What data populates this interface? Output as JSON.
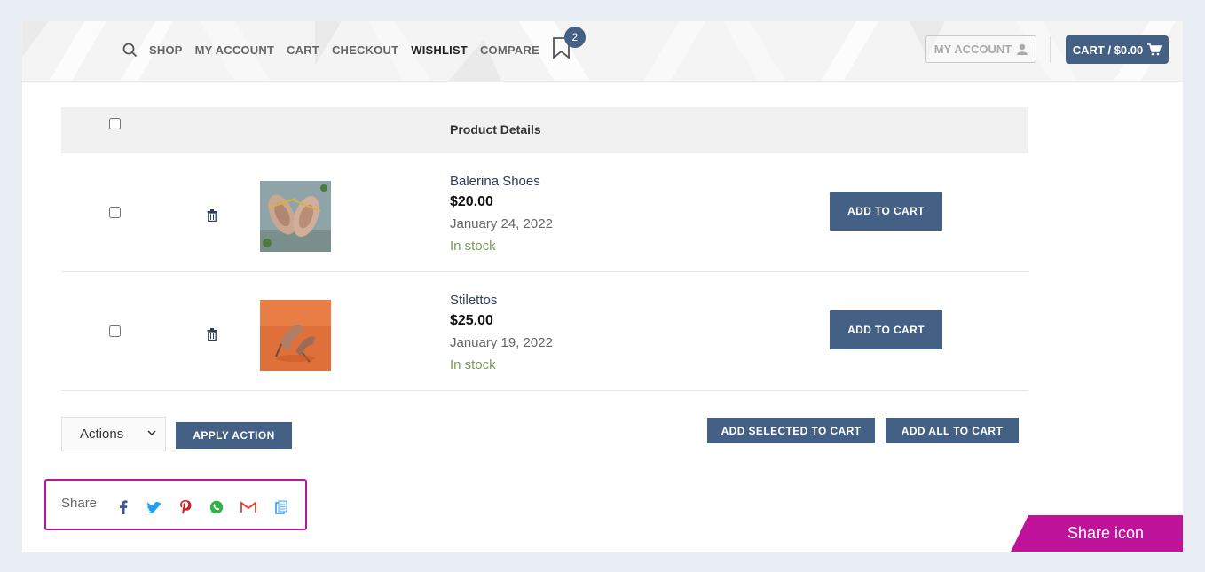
{
  "nav": {
    "items": [
      "SHOP",
      "MY ACCOUNT",
      "CART",
      "CHECKOUT",
      "WISHLIST",
      "COMPARE"
    ],
    "active": "WISHLIST",
    "wishlist_count": "2"
  },
  "header": {
    "account_button": "MY ACCOUNT",
    "cart_button": "CART / $0.00"
  },
  "table": {
    "header": "Product Details",
    "rows": [
      {
        "name": "Balerina Shoes",
        "price": "$20.00",
        "date": "January 24, 2022",
        "stock": "In stock",
        "button": "ADD TO CART"
      },
      {
        "name": "Stilettos",
        "price": "$25.00",
        "date": "January 19, 2022",
        "stock": "In stock",
        "button": "ADD TO CART"
      }
    ]
  },
  "controls": {
    "actions_select": "Actions",
    "apply_button": "APPLY ACTION",
    "add_selected": "ADD SELECTED TO CART",
    "add_all": "ADD ALL TO CART"
  },
  "share": {
    "label": "Share",
    "icons": [
      "facebook-icon",
      "twitter-icon",
      "pinterest-icon",
      "whatsapp-icon",
      "gmail-icon",
      "copy-link-icon"
    ]
  },
  "callout": {
    "text": "Share icon",
    "color": "#c0139b"
  },
  "colors": {
    "accent": "#446084",
    "stock": "#7a9c59",
    "highlight": "#b5179e"
  }
}
